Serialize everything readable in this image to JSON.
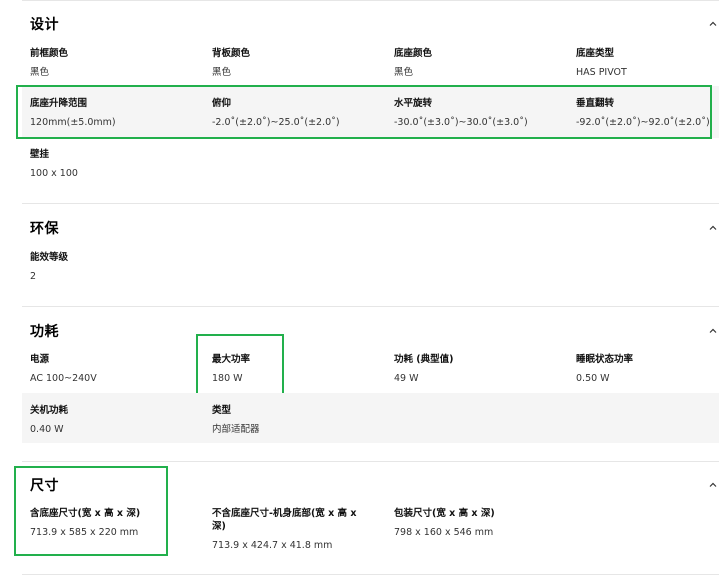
{
  "sections": {
    "design": {
      "title": "设计",
      "items": [
        {
          "label": "前框颜色",
          "value": "黑色"
        },
        {
          "label": "背板颜色",
          "value": "黑色"
        },
        {
          "label": "底座颜色",
          "value": "黑色"
        },
        {
          "label": "底座类型",
          "value": "HAS PIVOT"
        },
        {
          "label": "底座升降范围",
          "value": "120mm(±5.0mm)"
        },
        {
          "label": "俯仰",
          "value": "-2.0˚(±2.0˚)~25.0˚(±2.0˚)"
        },
        {
          "label": "水平旋转",
          "value": "-30.0˚(±3.0˚)~30.0˚(±3.0˚)"
        },
        {
          "label": "垂直翻转",
          "value": "-92.0˚(±2.0˚)~92.0˚(±2.0˚)"
        },
        {
          "label": "壁挂",
          "value": "100 x 100"
        }
      ]
    },
    "eco": {
      "title": "环保",
      "items": [
        {
          "label": "能效等级",
          "value": "2"
        }
      ]
    },
    "power": {
      "title": "功耗",
      "items": [
        {
          "label": "电源",
          "value": "AC 100~240V"
        },
        {
          "label": "最大功率",
          "value": "180 W"
        },
        {
          "label": "功耗 (典型值)",
          "value": "49 W"
        },
        {
          "label": "睡眠状态功率",
          "value": "0.50 W"
        },
        {
          "label": "关机功耗",
          "value": "0.40 W"
        },
        {
          "label": "类型",
          "value": "内部适配器"
        }
      ]
    },
    "dimensions": {
      "title": "尺寸",
      "items": [
        {
          "label": "含底座尺寸(宽 x 高 x 深)",
          "value": "713.9 x 585 x 220 mm"
        },
        {
          "label": "不含底座尺寸-机身底部(宽 x 高 x 深)",
          "value": "713.9 x 424.7 x 41.8 mm"
        },
        {
          "label": "包装尺寸(宽 x 高 x 深)",
          "value": "798 x 160 x 546 mm"
        }
      ]
    }
  },
  "icons": {
    "section_toggle": "chevron-up-icon"
  },
  "colors": {
    "highlight_box": "#22b04c",
    "row_background": "#f5f5f5"
  }
}
